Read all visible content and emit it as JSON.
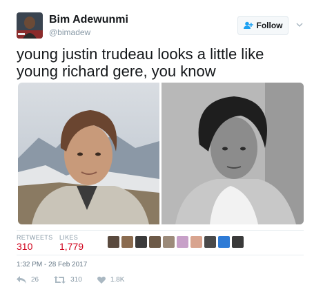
{
  "author": {
    "name": "Bim Adewunmi",
    "handle": "@bimadew"
  },
  "follow_label": "Follow",
  "tweet_text": "young justin trudeau looks a little like young richard gere, you know",
  "stats": {
    "retweets_label": "RETWEETS",
    "retweets_count": "310",
    "likes_label": "LIKES",
    "likes_count": "1,779"
  },
  "liker_colors": [
    "#5a4a3e",
    "#8a6b4f",
    "#3b3b3b",
    "#6d5a48",
    "#9c8b7a",
    "#c7a0c8",
    "#d8a48f",
    "#4a4a4a",
    "#2e7bd6",
    "#3a3a3a"
  ],
  "timestamp": "1:32 PM - 28 Feb 2017",
  "actions": {
    "reply_count": "26",
    "retweet_count": "310",
    "like_count": "1.8K"
  },
  "colors": {
    "stat_value": "#d0021b",
    "muted": "#8899a6",
    "follow_icon": "#1da1f2"
  },
  "icons": [
    "user-avatar",
    "add-user-icon",
    "chevron-down-icon",
    "reply-icon",
    "retweet-icon",
    "heart-icon"
  ]
}
